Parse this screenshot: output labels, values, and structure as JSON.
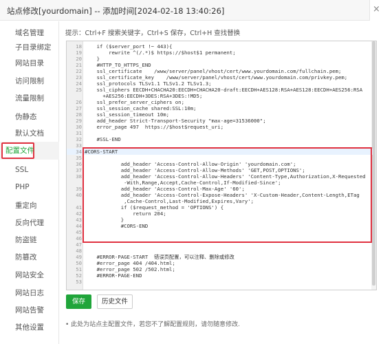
{
  "window": {
    "title": "站点修改[yourdomain] -- 添加时间[2024-02-18 13:40:26]",
    "close_label": "×"
  },
  "sidebar": {
    "items": [
      {
        "label": "域名管理",
        "name": "sidebar-item-domain"
      },
      {
        "label": "子目录绑定",
        "name": "sidebar-item-subdir"
      },
      {
        "label": "网站目录",
        "name": "sidebar-item-site-dir"
      },
      {
        "label": "访问限制",
        "name": "sidebar-item-access-limit"
      },
      {
        "label": "流量限制",
        "name": "sidebar-item-traffic-limit"
      },
      {
        "label": "伪静态",
        "name": "sidebar-item-rewrite"
      },
      {
        "label": "默认文档",
        "name": "sidebar-item-default-doc"
      },
      {
        "label": "配置文件",
        "name": "sidebar-item-config-file"
      },
      {
        "label": "SSL",
        "name": "sidebar-item-ssl"
      },
      {
        "label": "PHP",
        "name": "sidebar-item-php"
      },
      {
        "label": "重定向",
        "name": "sidebar-item-redirect"
      },
      {
        "label": "反向代理",
        "name": "sidebar-item-reverse-proxy"
      },
      {
        "label": "防盗链",
        "name": "sidebar-item-hotlink"
      },
      {
        "label": "防篡改",
        "name": "sidebar-item-tamper"
      },
      {
        "label": "网站安全",
        "name": "sidebar-item-security"
      },
      {
        "label": "网站日志",
        "name": "sidebar-item-log"
      },
      {
        "label": "网站告警",
        "name": "sidebar-item-alert"
      },
      {
        "label": "其他设置",
        "name": "sidebar-item-other"
      }
    ],
    "active_index": 7
  },
  "editor": {
    "tip": "提示：Ctrl+F 搜索关键字，Ctrl+S 保存，Ctrl+H 查找替换",
    "highlighted_line": "34",
    "lines": [
      {
        "num": "18",
        "text": "    if ($server_port !~ 443){"
      },
      {
        "num": "19",
        "text": "        rewrite ^(/.*)$ https://$host$1 permanent;"
      },
      {
        "num": "20",
        "text": "    }"
      },
      {
        "num": "21",
        "text": "    #HTTP_TO_HTTPS_END"
      },
      {
        "num": "22",
        "text": "    ssl_certificate    /www/server/panel/vhost/cert/www.yourdomain.com/fullchain.pem;"
      },
      {
        "num": "23",
        "text": "    ssl_certificate_key    /www/server/panel/vhost/cert/www.yourdomain.com/privkey.pem;"
      },
      {
        "num": "24",
        "text": "    ssl_protocols TLSv1.1 TLSv1.2 TLSv1.3;"
      },
      {
        "num": "25",
        "text": "    ssl_ciphers EECDH+CHACHA20:EECDH+CHACHA20-draft:EECDH+AES128:RSA+AES128:EECDH+AES256:RSA"
      },
      {
        "num": "",
        "text": "      +AES256:EECDH+3DES:RSA+3DES:!MD5;"
      },
      {
        "num": "26",
        "text": "    ssl_prefer_server_ciphers on;"
      },
      {
        "num": "27",
        "text": "    ssl_session_cache shared:SSL:10m;"
      },
      {
        "num": "28",
        "text": "    ssl_session_timeout 10m;"
      },
      {
        "num": "29",
        "text": "    add_header Strict-Transport-Security \"max-age=31536000\";"
      },
      {
        "num": "30",
        "text": "    error_page 497  https://$host$request_uri;"
      },
      {
        "num": "31",
        "text": ""
      },
      {
        "num": "32",
        "text": "    #SSL-END"
      },
      {
        "num": "33",
        "text": ""
      },
      {
        "num": "34",
        "text": "#CORS-START"
      },
      {
        "num": "35",
        "text": ""
      },
      {
        "num": "36",
        "text": "            add_header 'Access-Control-Allow-Origin' 'yourdomain.com';"
      },
      {
        "num": "37",
        "text": "            add_header 'Access-Control-Allow-Methods' 'GET,POST,OPTIONS';"
      },
      {
        "num": "38",
        "text": "            add_header 'Access-Control-Allow-Headers' 'Content-Type,Authorization,X-Requested"
      },
      {
        "num": "",
        "text": "             -With,Range,Accept,Cache-Control,If-Modified-Since';"
      },
      {
        "num": "39",
        "text": "            add_header 'Access-Control-Max-Age' '60';"
      },
      {
        "num": "40",
        "text": "            add_header 'Access-Control-Expose-Headers' 'X-Custom-Header,Content-Length,ETag"
      },
      {
        "num": "",
        "text": "             ,Cache-Control,Last-Modified,Expires,Vary';"
      },
      {
        "num": "41",
        "text": "            if ($request_method = 'OPTIONS') {"
      },
      {
        "num": "42",
        "text": "                return 204;"
      },
      {
        "num": "43",
        "text": "            }"
      },
      {
        "num": "44",
        "text": "            #CORS-END"
      },
      {
        "num": "45",
        "text": ""
      },
      {
        "num": "46",
        "text": ""
      },
      {
        "num": "47",
        "text": ""
      },
      {
        "num": "48",
        "text": ""
      },
      {
        "num": "49",
        "text": "    #ERROR-PAGE-START  错误页配置，可以注释、删除或修改"
      },
      {
        "num": "50",
        "text": "    #error_page 404 /404.html;"
      },
      {
        "num": "51",
        "text": "    #error_page 502 /502.html;"
      },
      {
        "num": "52",
        "text": "    #ERROR-PAGE-END"
      },
      {
        "num": "53",
        "text": ""
      }
    ]
  },
  "buttons": {
    "save": "保存",
    "history": "历史文件"
  },
  "note": "•  此处为站点主配置文件，若您不了解配置规则，请勿随意修改.",
  "colors": {
    "accent": "#20a53a",
    "highlight_border": "#e0303f"
  }
}
